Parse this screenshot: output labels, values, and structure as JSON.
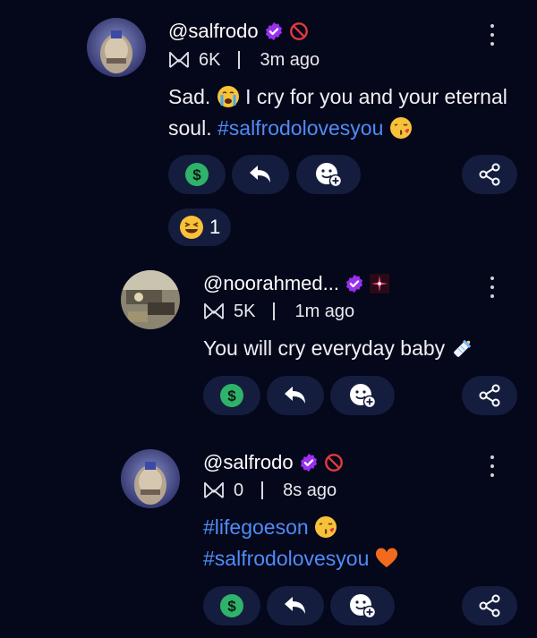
{
  "comments": [
    {
      "username": "@salfrodo",
      "marks": "6K",
      "time": "3m ago",
      "text_parts": [
        "Sad. ",
        " I cry for you and your eternal soul. "
      ],
      "hashtag": "#salfrodolovesyou",
      "reaction_count": "1",
      "icons": [
        "verified-badge-icon",
        "blocked-badge-icon",
        "crying-face-emoji",
        "kissing-face-emoji"
      ]
    },
    {
      "username": "@noorahmed...",
      "marks": "5K",
      "time": "1m ago",
      "text": "You will cry everyday baby ",
      "icons": [
        "verified-badge-icon",
        "sparkle-badge-icon",
        "baby-bottle-emoji"
      ]
    },
    {
      "username": "@salfrodo",
      "marks": "0",
      "time": "8s ago",
      "hashtag1": "#lifegoeson",
      "hashtag2": "#salfrodolovesyou",
      "icons": [
        "verified-badge-icon",
        "blocked-badge-icon",
        "kissing-face-emoji",
        "orange-heart-emoji"
      ]
    }
  ],
  "colors": {
    "background": "#05071a",
    "pill": "#141d3e",
    "hashtag": "#4f8cf7",
    "tip_green": "#2fb36a",
    "verified_purple": "#9b2ff0",
    "blocked_red": "#e23b3b"
  }
}
